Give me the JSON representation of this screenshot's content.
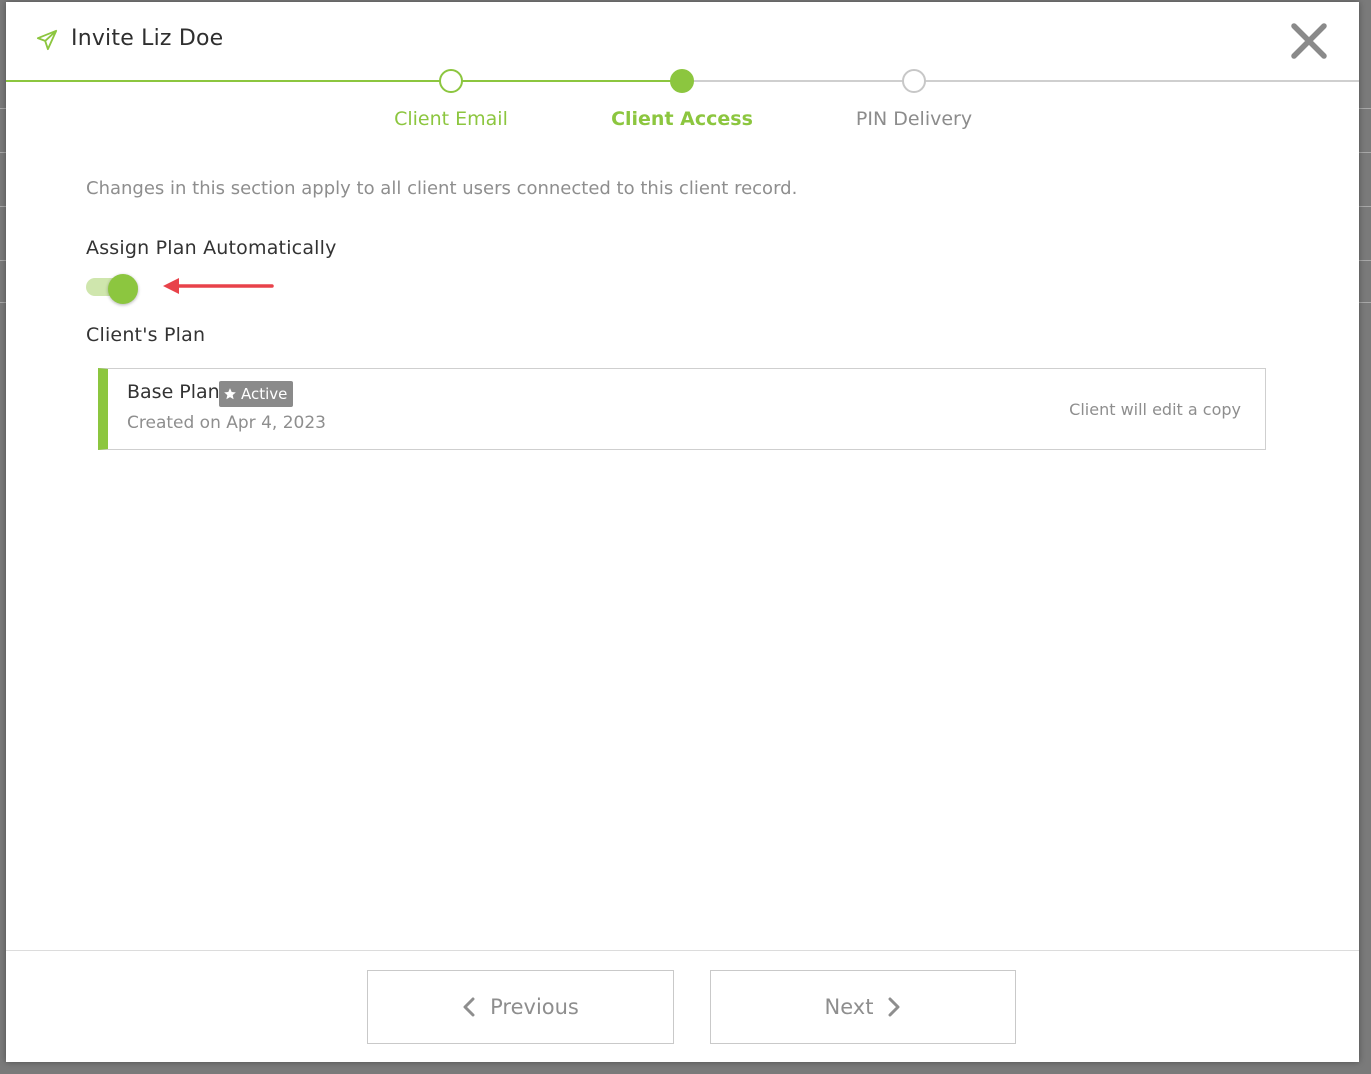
{
  "dialog": {
    "title": "Invite Liz Doe",
    "icon": "send-icon",
    "close_icon": "close-icon"
  },
  "stepper": {
    "steps": [
      {
        "label": "Client Email",
        "state": "completed"
      },
      {
        "label": "Client Access",
        "state": "current"
      },
      {
        "label": "PIN Delivery",
        "state": "upcoming"
      }
    ]
  },
  "content": {
    "intro": "Changes in this section apply to all client users connected to this client record.",
    "assign_label": "Assign Plan Automatically",
    "assign_enabled": true,
    "plan_section_label": "Client's Plan",
    "plan": {
      "name": "Base Plan",
      "badge": "Active",
      "badge_icon": "star-icon",
      "created": "Created on Apr 4, 2023",
      "note": "Client will edit a copy"
    }
  },
  "footer": {
    "previous_label": "Previous",
    "next_label": "Next"
  },
  "colors": {
    "accent": "#8cc63f",
    "annotation_arrow": "#e8424a",
    "muted_text": "#8e8e8e"
  }
}
